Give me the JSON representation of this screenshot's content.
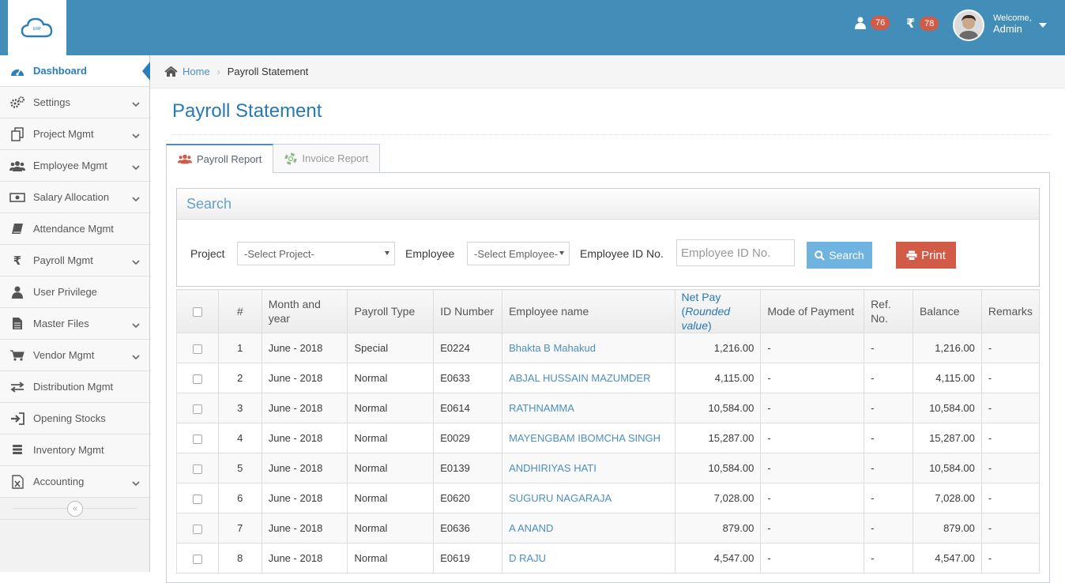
{
  "header": {
    "logo_text": "ERP",
    "users_badge": "76",
    "currency_symbol": "₹",
    "currency_badge": "78",
    "welcome_label": "Welcome,",
    "user_name": "Admin"
  },
  "sidebar": {
    "items": [
      {
        "label": "Dashboard",
        "icon": "dashboard-icon"
      },
      {
        "label": "Settings",
        "icon": "cogs-icon"
      },
      {
        "label": "Project Mgmt",
        "icon": "files-icon"
      },
      {
        "label": "Employee Mgmt",
        "icon": "users-icon"
      },
      {
        "label": "Salary Allocation",
        "icon": "money-icon"
      },
      {
        "label": "Attendance Mgmt",
        "icon": "book-icon"
      },
      {
        "label": "Payroll Mgmt",
        "icon": "rupee-icon"
      },
      {
        "label": "User Privilege",
        "icon": "user-icon"
      },
      {
        "label": "Master Files",
        "icon": "file-text-icon"
      },
      {
        "label": "Vendor Mgmt",
        "icon": "cart-icon"
      },
      {
        "label": "Distribution Mgmt",
        "icon": "exchange-icon"
      },
      {
        "label": "Opening Stocks",
        "icon": "sign-in-icon"
      },
      {
        "label": "Inventory Mgmt",
        "icon": "database-icon"
      },
      {
        "label": "Accounting",
        "icon": "excel-file-icon"
      }
    ]
  },
  "breadcrumb": {
    "home": "Home",
    "current": "Payroll Statement"
  },
  "page": {
    "title": "Payroll Statement"
  },
  "tabs": [
    {
      "label": "Payroll Report"
    },
    {
      "label": "Invoice Report"
    }
  ],
  "search": {
    "title": "Search",
    "project_label": "Project",
    "project_value": "-Select Project-",
    "employee_label": "Employee",
    "employee_value": "-Select Employee-",
    "empid_label": "Employee ID No.",
    "empid_placeholder": "Employee ID No.",
    "search_button": "Search",
    "print_button": "Print"
  },
  "table": {
    "headers": {
      "num": "#",
      "month": "Month and year",
      "type": "Payroll Type",
      "id": "ID Number",
      "name": "Employee name",
      "netpay": "Net Pay",
      "netpay_note": "Rounded value",
      "mode": "Mode of Payment",
      "ref": "Ref. No.",
      "balance": "Balance",
      "remarks": "Remarks"
    },
    "rows": [
      {
        "num": "1",
        "month": "June - 2018",
        "type": "Special",
        "id": "E0224",
        "name": "Bhakta B Mahakud",
        "netpay": "1,216.00",
        "mode": "-",
        "ref": "-",
        "balance": "1,216.00",
        "remarks": "-"
      },
      {
        "num": "2",
        "month": "June - 2018",
        "type": "Normal",
        "id": "E0633",
        "name": "ABJAL HUSSAIN MAZUMDER",
        "netpay": "4,115.00",
        "mode": "-",
        "ref": "-",
        "balance": "4,115.00",
        "remarks": "-"
      },
      {
        "num": "3",
        "month": "June - 2018",
        "type": "Normal",
        "id": "E0614",
        "name": "RATHNAMMA",
        "netpay": "10,584.00",
        "mode": "-",
        "ref": "-",
        "balance": "10,584.00",
        "remarks": "-"
      },
      {
        "num": "4",
        "month": "June - 2018",
        "type": "Normal",
        "id": "E0029",
        "name": "MAYENGBAM IBOMCHA SINGH",
        "netpay": "15,287.00",
        "mode": "-",
        "ref": "-",
        "balance": "15,287.00",
        "remarks": "-"
      },
      {
        "num": "5",
        "month": "June - 2018",
        "type": "Normal",
        "id": "E0139",
        "name": "ANDHIRIYAS HATI",
        "netpay": "10,584.00",
        "mode": "-",
        "ref": "-",
        "balance": "10,584.00",
        "remarks": "-"
      },
      {
        "num": "6",
        "month": "June - 2018",
        "type": "Normal",
        "id": "E0620",
        "name": "SUGURU NAGARAJA",
        "netpay": "7,028.00",
        "mode": "-",
        "ref": "-",
        "balance": "7,028.00",
        "remarks": "-"
      },
      {
        "num": "7",
        "month": "June - 2018",
        "type": "Normal",
        "id": "E0636",
        "name": "A ANAND",
        "netpay": "879.00",
        "mode": "-",
        "ref": "-",
        "balance": "879.00",
        "remarks": "-"
      },
      {
        "num": "8",
        "month": "June - 2018",
        "type": "Normal",
        "id": "E0619",
        "name": "D RAJU",
        "netpay": "4,547.00",
        "mode": "-",
        "ref": "-",
        "balance": "4,547.00",
        "remarks": "-"
      }
    ]
  }
}
